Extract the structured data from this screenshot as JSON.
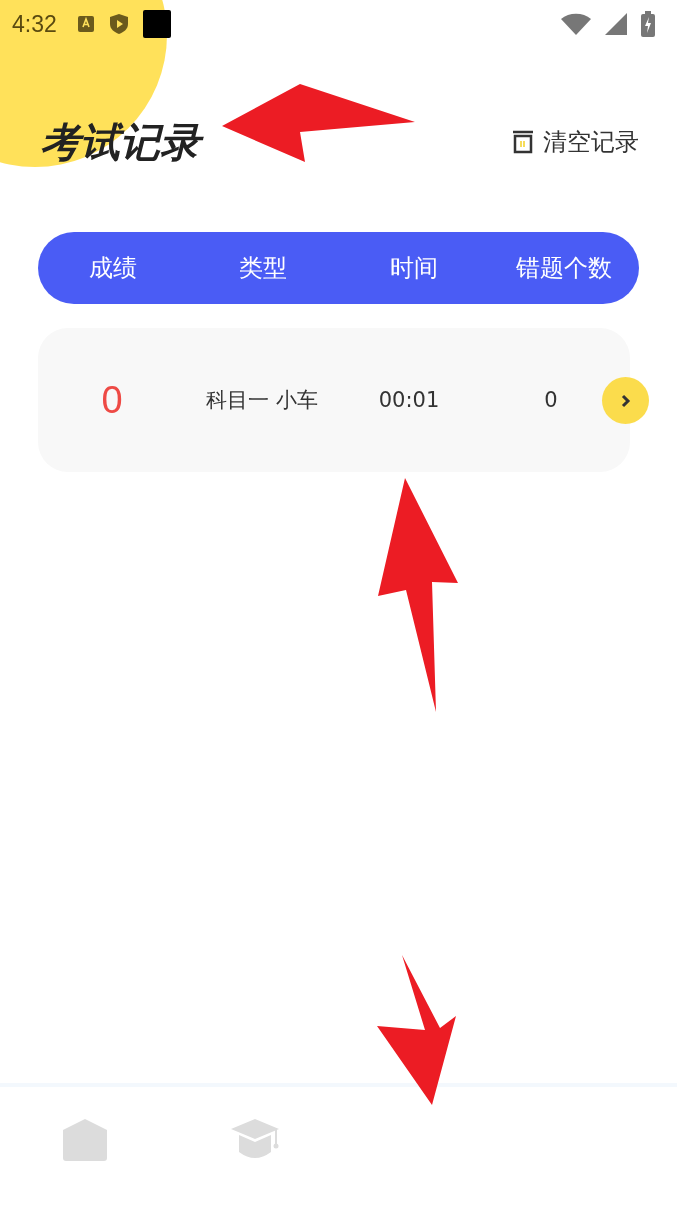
{
  "status_bar": {
    "time": "4:32"
  },
  "title": "考试记录",
  "clear_button": {
    "label": "清空记录"
  },
  "table": {
    "columns": [
      "成绩",
      "类型",
      "时间",
      "错题个数"
    ],
    "rows": [
      {
        "score": "0",
        "type": "科目一 小车",
        "time": "00:01",
        "wrong_count": "0"
      }
    ]
  },
  "bottom_nav": [
    {
      "kind": "home",
      "selected": false
    },
    {
      "kind": "cap",
      "selected": false
    }
  ]
}
